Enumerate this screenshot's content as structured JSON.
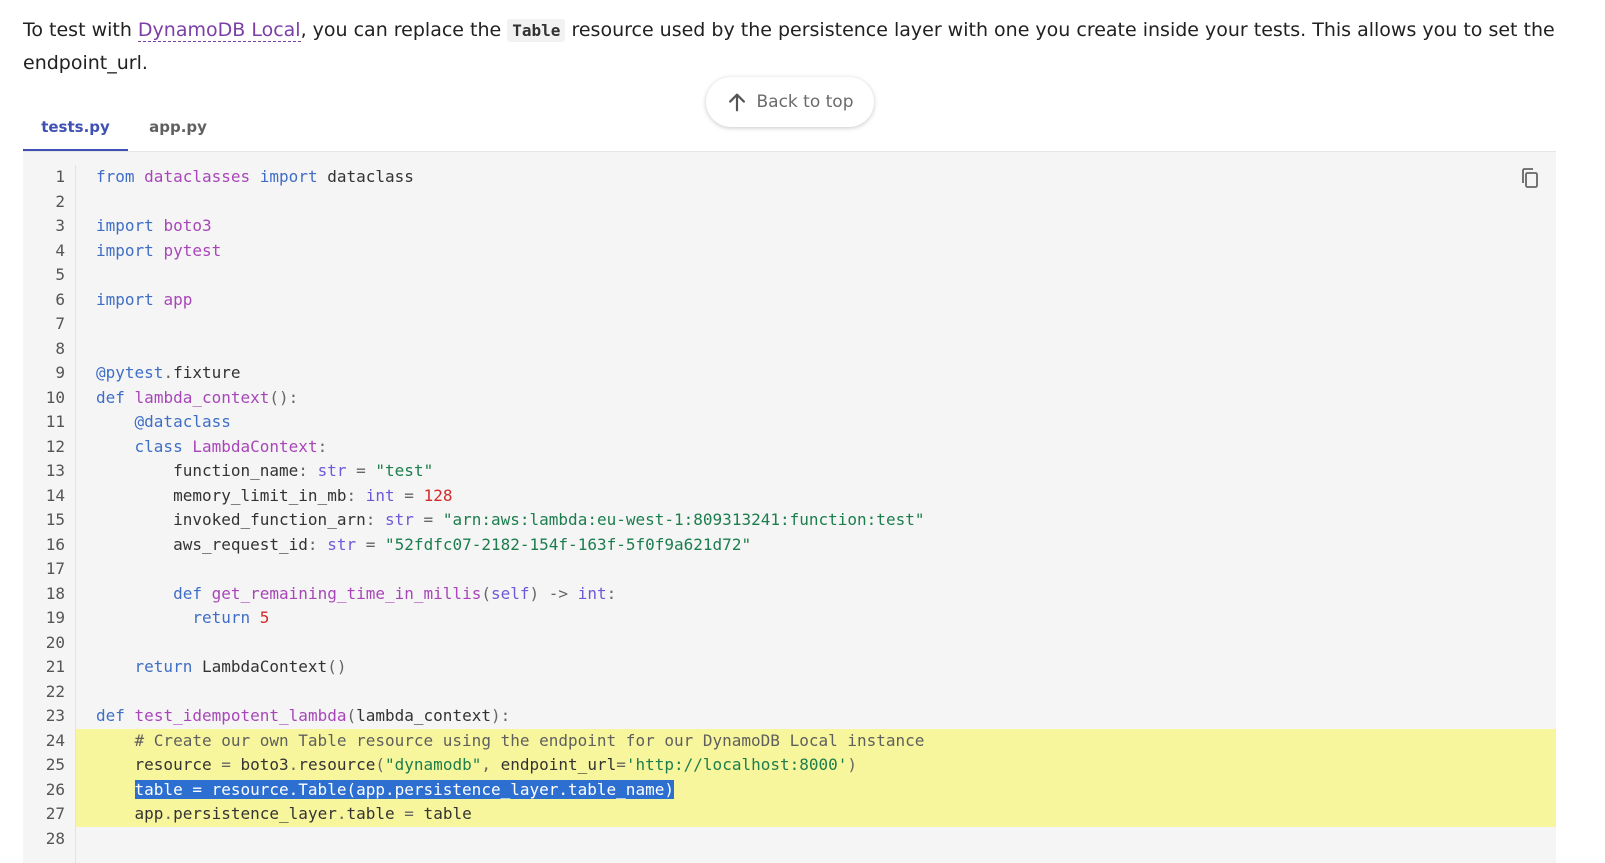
{
  "intro": {
    "prefix": "To test with ",
    "link_text": "DynamoDB Local",
    "middle": ", you can replace the ",
    "code_word": "Table",
    "suffix": " resource used by the persistence layer with one you create inside your tests. This allows you to set the endpoint_url."
  },
  "back_to_top": {
    "label": "Back to top"
  },
  "tabs": [
    {
      "label": "tests.py",
      "active": true
    },
    {
      "label": "app.py",
      "active": false
    }
  ],
  "colors": {
    "accent": "#4051b5",
    "highlight": "#f8f69c",
    "selection": "#2c6fd0"
  },
  "code": {
    "lines": [
      {
        "n": "1",
        "tokens": [
          [
            "kw",
            "from"
          ],
          [
            "",
            " "
          ],
          [
            "mod",
            "dataclasses"
          ],
          [
            "",
            " "
          ],
          [
            "kw",
            "import"
          ],
          [
            "",
            " dataclass"
          ]
        ]
      },
      {
        "n": "2",
        "tokens": []
      },
      {
        "n": "3",
        "tokens": [
          [
            "kw",
            "import"
          ],
          [
            "",
            " "
          ],
          [
            "mod",
            "boto3"
          ]
        ]
      },
      {
        "n": "4",
        "tokens": [
          [
            "kw",
            "import"
          ],
          [
            "",
            " "
          ],
          [
            "mod",
            "pytest"
          ]
        ]
      },
      {
        "n": "5",
        "tokens": []
      },
      {
        "n": "6",
        "tokens": [
          [
            "kw",
            "import"
          ],
          [
            "",
            " "
          ],
          [
            "mod",
            "app"
          ]
        ]
      },
      {
        "n": "7",
        "tokens": []
      },
      {
        "n": "8",
        "tokens": []
      },
      {
        "n": "9",
        "tokens": [
          [
            "dec",
            "@pytest"
          ],
          [
            "pun",
            "."
          ],
          [
            "",
            "fixture"
          ]
        ]
      },
      {
        "n": "10",
        "tokens": [
          [
            "kw",
            "def"
          ],
          [
            "",
            " "
          ],
          [
            "fn",
            "lambda_context"
          ],
          [
            "pun",
            "():"
          ]
        ]
      },
      {
        "n": "11",
        "tokens": [
          [
            "",
            "    "
          ],
          [
            "dec",
            "@dataclass"
          ]
        ]
      },
      {
        "n": "12",
        "tokens": [
          [
            "",
            "    "
          ],
          [
            "kw",
            "class"
          ],
          [
            "",
            " "
          ],
          [
            "fn",
            "LambdaContext"
          ],
          [
            "pun",
            ":"
          ]
        ]
      },
      {
        "n": "13",
        "tokens": [
          [
            "",
            "        function_name"
          ],
          [
            "pun",
            ":"
          ],
          [
            "",
            " "
          ],
          [
            "typ",
            "str"
          ],
          [
            "",
            " "
          ],
          [
            "pun",
            "="
          ],
          [
            "",
            " "
          ],
          [
            "str",
            "\"test\""
          ]
        ]
      },
      {
        "n": "14",
        "tokens": [
          [
            "",
            "        memory_limit_in_mb"
          ],
          [
            "pun",
            ":"
          ],
          [
            "",
            " "
          ],
          [
            "typ",
            "int"
          ],
          [
            "",
            " "
          ],
          [
            "pun",
            "="
          ],
          [
            "",
            " "
          ],
          [
            "num",
            "128"
          ]
        ]
      },
      {
        "n": "15",
        "tokens": [
          [
            "",
            "        invoked_function_arn"
          ],
          [
            "pun",
            ":"
          ],
          [
            "",
            " "
          ],
          [
            "typ",
            "str"
          ],
          [
            "",
            " "
          ],
          [
            "pun",
            "="
          ],
          [
            "",
            " "
          ],
          [
            "str",
            "\"arn:aws:lambda:eu-west-1:809313241:function:test\""
          ]
        ]
      },
      {
        "n": "16",
        "tokens": [
          [
            "",
            "        aws_request_id"
          ],
          [
            "pun",
            ":"
          ],
          [
            "",
            " "
          ],
          [
            "typ",
            "str"
          ],
          [
            "",
            " "
          ],
          [
            "pun",
            "="
          ],
          [
            "",
            " "
          ],
          [
            "str",
            "\"52fdfc07-2182-154f-163f-5f0f9a621d72\""
          ]
        ]
      },
      {
        "n": "17",
        "tokens": []
      },
      {
        "n": "18",
        "tokens": [
          [
            "",
            "        "
          ],
          [
            "kw",
            "def"
          ],
          [
            "",
            " "
          ],
          [
            "fn",
            "get_remaining_time_in_millis"
          ],
          [
            "pun",
            "("
          ],
          [
            "typ",
            "self"
          ],
          [
            "pun",
            ")"
          ],
          [
            "",
            " "
          ],
          [
            "pun",
            "->"
          ],
          [
            "",
            " "
          ],
          [
            "typ",
            "int"
          ],
          [
            "pun",
            ":"
          ]
        ]
      },
      {
        "n": "19",
        "tokens": [
          [
            "",
            "          "
          ],
          [
            "kw",
            "return"
          ],
          [
            "",
            " "
          ],
          [
            "num",
            "5"
          ]
        ]
      },
      {
        "n": "20",
        "tokens": []
      },
      {
        "n": "21",
        "tokens": [
          [
            "",
            "    "
          ],
          [
            "kw",
            "return"
          ],
          [
            "",
            " LambdaContext"
          ],
          [
            "pun",
            "()"
          ]
        ]
      },
      {
        "n": "22",
        "tokens": []
      },
      {
        "n": "23",
        "tokens": [
          [
            "kw",
            "def"
          ],
          [
            "",
            " "
          ],
          [
            "fn",
            "test_idempotent_lambda"
          ],
          [
            "pun",
            "("
          ],
          [
            "",
            "lambda_context"
          ],
          [
            "pun",
            "):"
          ]
        ]
      },
      {
        "n": "24",
        "hl": true,
        "tokens": [
          [
            "",
            "    "
          ],
          [
            "cm",
            "# Create our own Table resource using the endpoint for our DynamoDB Local instance"
          ]
        ]
      },
      {
        "n": "25",
        "hl": true,
        "tokens": [
          [
            "",
            "    resource "
          ],
          [
            "pun",
            "="
          ],
          [
            "",
            " boto3"
          ],
          [
            "pun",
            "."
          ],
          [
            "",
            "resource"
          ],
          [
            "pun",
            "("
          ],
          [
            "str",
            "\"dynamodb\""
          ],
          [
            "pun",
            ","
          ],
          [
            "",
            " endpoint_url"
          ],
          [
            "pun",
            "="
          ],
          [
            "str",
            "'http://localhost:8000'"
          ],
          [
            "pun",
            ")"
          ]
        ]
      },
      {
        "n": "26",
        "hl": true,
        "tokens": [
          [
            "",
            "    "
          ],
          [
            "sel",
            "table = resource.Table(app.persistence_layer.table_name)"
          ]
        ]
      },
      {
        "n": "27",
        "hl": true,
        "tokens": [
          [
            "",
            "    app"
          ],
          [
            "pun",
            "."
          ],
          [
            "",
            "persistence_layer"
          ],
          [
            "pun",
            "."
          ],
          [
            "",
            "table "
          ],
          [
            "pun",
            "="
          ],
          [
            "",
            " table"
          ]
        ]
      },
      {
        "n": "28",
        "tokens": []
      }
    ]
  }
}
